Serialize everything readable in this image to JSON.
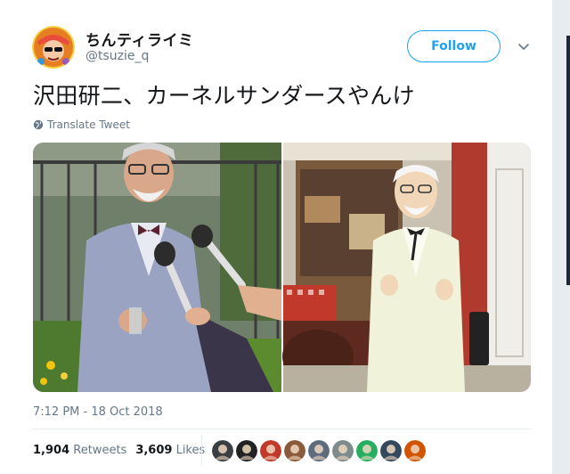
{
  "tweet": {
    "display_name": "ちんティライミ",
    "username": "@tsuzie_q",
    "follow_label": "Follow",
    "text": "沢田研二、カーネルサンダースやんけ",
    "translate_label": "Translate Tweet",
    "timestamp": "7:12 PM - 18 Oct 2018"
  },
  "stats": {
    "retweets_count": "1,904",
    "retweets_label": "Retweets",
    "likes_count": "3,609",
    "likes_label": "Likes"
  },
  "likers": [
    {
      "name": "liker-avatar-1",
      "color": "#3a3f44"
    },
    {
      "name": "liker-avatar-2",
      "color": "#222222"
    },
    {
      "name": "liker-avatar-3",
      "color": "#c0392b"
    },
    {
      "name": "liker-avatar-4",
      "color": "#8a5a3b"
    },
    {
      "name": "liker-avatar-5",
      "color": "#5d6d7e"
    },
    {
      "name": "liker-avatar-6",
      "color": "#7f8c8d"
    },
    {
      "name": "liker-avatar-7",
      "color": "#27ae60"
    },
    {
      "name": "liker-avatar-8",
      "color": "#34495e"
    },
    {
      "name": "liker-avatar-9",
      "color": "#d35400"
    }
  ],
  "colors": {
    "accent": "#1da1f2",
    "muted": "#657786",
    "text": "#14171a"
  },
  "icons": {
    "avatar": "user-avatar",
    "caret": "chevron-down-icon",
    "translate": "globe-icon"
  }
}
